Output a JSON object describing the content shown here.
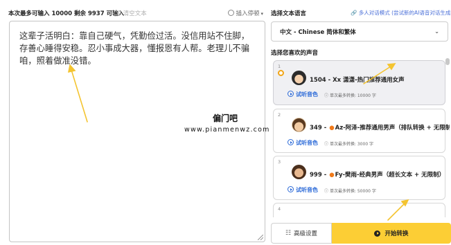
{
  "editor": {
    "limit_text": "本次最多可输入 10000 剩余 9937 可输入",
    "clear_label": "清空文本",
    "pause_label": "插入停顿",
    "content": "这辈子活明白：靠自己硬气，凭勤俭过活。没信用站不住脚，存善心睡得安稳。忍小事成大器，懂报恩有人帮。老理儿不骗咱，照着做准没错。"
  },
  "watermark": {
    "title": "偏门吧",
    "url": "www.pianmenwz.com"
  },
  "language": {
    "label": "选择文本语言",
    "multi_mode_link": "多人对话模式 (尝试新的AI语音对话生成器",
    "selected": "中文 - Chinese 简体和繁体"
  },
  "voices": {
    "label": "选择您喜欢的声音",
    "audition_label": "试听音色",
    "items": [
      {
        "index": "1",
        "name": "1504 - Xx 潇潇-热门推荐通用女声",
        "hot": false,
        "limit": "单次最多转换: 10000 字",
        "selected": true
      },
      {
        "index": "2",
        "name": "349 - ",
        "name_rest": "Az-阿泽-推荐通用男声（排队转换 + 无限制）",
        "hot": true,
        "limit": "单次最多转换: 3000 字",
        "selected": false
      },
      {
        "index": "3",
        "name": "999 - ",
        "name_rest": "Fy-樊雨-经典男声（超长文本 + 无限制）",
        "hot": true,
        "limit": "单次最多转换: 50000 字",
        "selected": false
      },
      {
        "index": "4"
      }
    ]
  },
  "actions": {
    "advanced_label": "高级设置",
    "start_label": "开始转换"
  },
  "colors": {
    "accent_yellow": "#fcce35",
    "link_blue": "#2d6bd8",
    "selected_ring": "#f2a516",
    "hot_orange": "#f07a1a"
  }
}
